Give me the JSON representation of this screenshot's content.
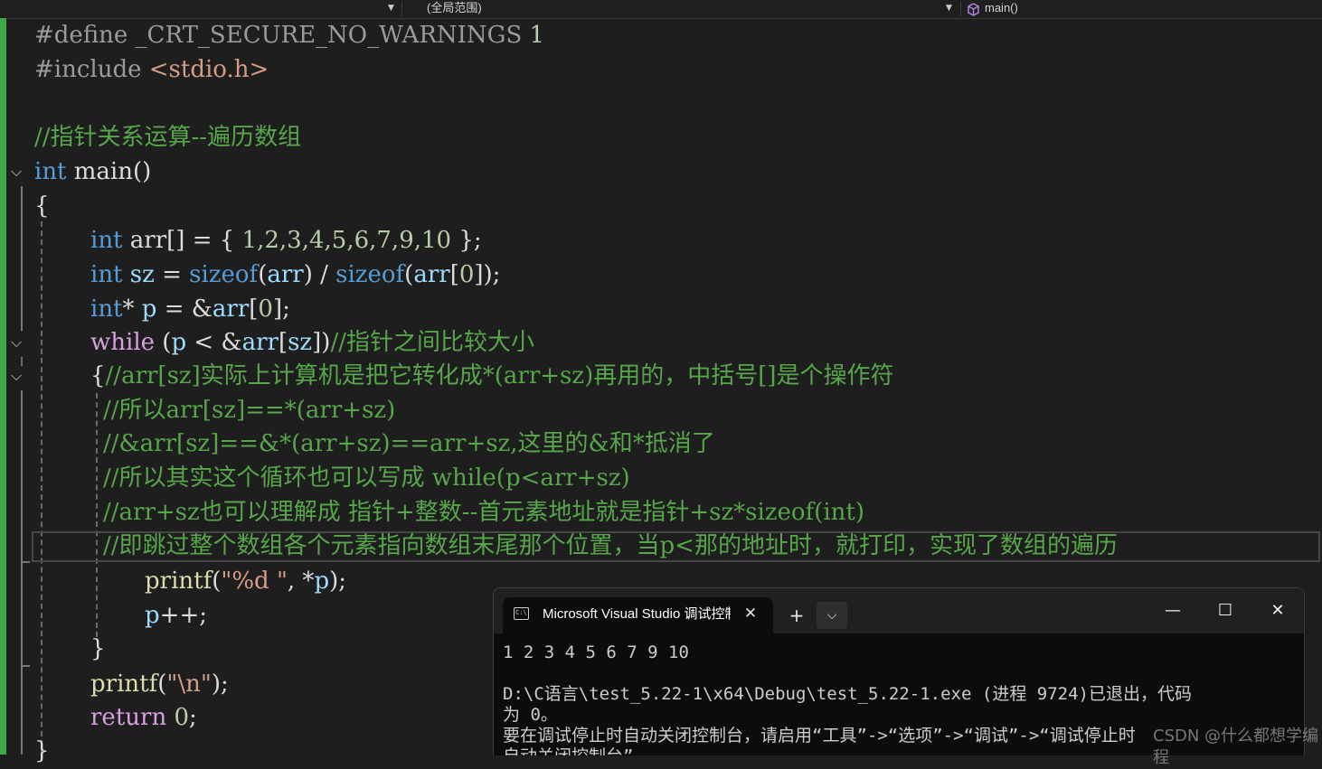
{
  "navbar": {
    "scope": "(全局范围)",
    "function": "main()"
  },
  "code": {
    "l1": {
      "a": "#define _CRT_SECURE_NO_WARNINGS",
      "b": " 1"
    },
    "l2": {
      "a": "#include ",
      "b": "<stdio.h>"
    },
    "l4": "//指针关系运算--遍历数组",
    "l5": {
      "a": "int",
      "b": " main()"
    },
    "l6": "{",
    "l7": {
      "a": "int",
      "b": " arr[] = { ",
      "c": "1,2,3,4,5,6,7,9,10",
      "d": " };"
    },
    "l8": {
      "a": "int",
      "b": " sz",
      "c": " = ",
      "d": "sizeof",
      "e": "(",
      "f": "arr",
      "g": ") / ",
      "h": "sizeof",
      "i": "(",
      "j": "arr",
      "k": "[",
      "l": "0",
      "m": "]);"
    },
    "l9": {
      "a": "int",
      "b": "* ",
      "c": "p",
      "d": " = &",
      "e": "arr",
      "f": "[",
      "g": "0",
      "h": "];"
    },
    "l10": {
      "a": "while",
      "b": " (",
      "c": "p",
      "d": " < &",
      "e": "arr",
      "f": "[",
      "g": "sz",
      "h": "])",
      "i": "//指针之间比较大小"
    },
    "l11": {
      "a": "{",
      "b": "//arr[sz]实际上计算机是把它转化成*(arr+sz)再用的，中括号[]是个操作符"
    },
    "l12": "//所以arr[sz]==*(arr+sz)",
    "l13": "//&arr[sz]==&*(arr+sz)==arr+sz,这里的&和*抵消了",
    "l14": "//所以其实这个循环也可以写成 while(p<arr+sz)",
    "l15": "//arr+sz也可以理解成 指针+整数--首元素地址就是指针+sz*sizeof(int)",
    "l16": "//即跳过整个数组各个元素指向数组末尾那个位置，当p<那的地址时，就打印，实现了数组的遍历",
    "l17": {
      "a": "printf",
      "b": "(",
      "c": "\"%d \"",
      "d": ", *",
      "e": "p",
      "f": ");"
    },
    "l18": {
      "a": "p",
      "b": "++;"
    },
    "l19": "}",
    "l20": {
      "a": "printf",
      "b": "(",
      "c": "\"\\n\"",
      "d": ");"
    },
    "l21": {
      "a": "return",
      "b": " ",
      "c": "0",
      "d": ";"
    },
    "l22": "}"
  },
  "console": {
    "tab_title": "Microsoft Visual Studio 调试控制台",
    "tab_icon": "terminal-icon",
    "new_tab": "+",
    "dropdown": "⌵",
    "minimize": "—",
    "maximize": "☐",
    "close": "✕",
    "output": [
      "1 2 3 4 5 6 7 9 10",
      "",
      "D:\\C语言\\test_5.22-1\\x64\\Debug\\test_5.22-1.exe (进程 9724)已退出，代码",
      "为 0。",
      "要在调试停止时自动关闭控制台，请启用“工具”->“选项”->“调试”->“调试停止时",
      "自动关闭控制台”。"
    ]
  },
  "watermark": "CSDN @什么都想学编程",
  "colors": {
    "keyword": "#569cd6",
    "control": "#d8a0df",
    "comment": "#57a64a",
    "function": "#dcdcaa",
    "variable": "#9cdcfe",
    "string": "#d69d85",
    "number": "#b5cea8",
    "change_bar": "#3fa94a",
    "background": "#1e1e1e"
  }
}
